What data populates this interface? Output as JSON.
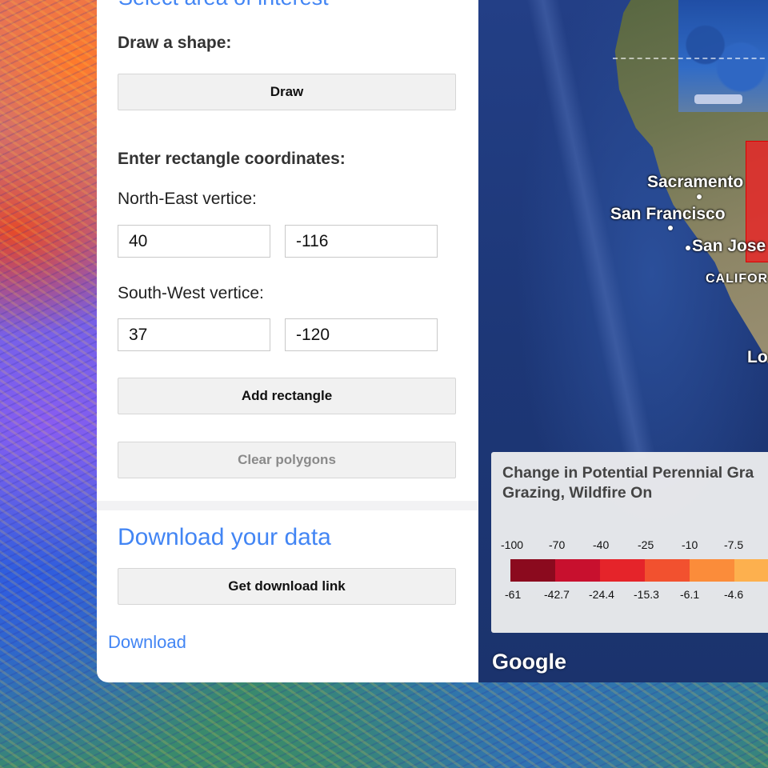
{
  "panel": {
    "section_title": "Select area of interest",
    "draw_label": "Draw a shape:",
    "draw_button": "Draw",
    "rect_label": "Enter rectangle coordinates:",
    "ne_label": "North-East vertice:",
    "ne_lat": "40",
    "ne_lon": "-116",
    "sw_label": "South-West vertice:",
    "sw_lat": "37",
    "sw_lon": "-120",
    "add_rect_button": "Add rectangle",
    "clear_button": "Clear polygons",
    "download_title": "Download your data",
    "get_link_button": "Get download link",
    "download_link": "Download"
  },
  "map": {
    "cities": {
      "sacramento": "Sacramento",
      "san_francisco": "San Francisco",
      "san_jose": "San Jose",
      "california": "CALIFOR",
      "los_angeles": "Lo"
    },
    "attribution": "Google"
  },
  "legend": {
    "title_line1": "Change in Potential Perennial Gra",
    "title_line2": "Grazing, Wildfire On",
    "top_ticks": [
      "-100",
      "-70",
      "-40",
      "-25",
      "-10",
      "-7.5"
    ],
    "bottom_ticks": [
      "-61",
      "-42.7",
      "-24.4",
      "-15.3",
      "-6.1",
      "-4.6"
    ],
    "colors": [
      "#8b0a1e",
      "#c8102e",
      "#e5242a",
      "#f2512f",
      "#fb8c3a",
      "#fdb04e"
    ]
  }
}
